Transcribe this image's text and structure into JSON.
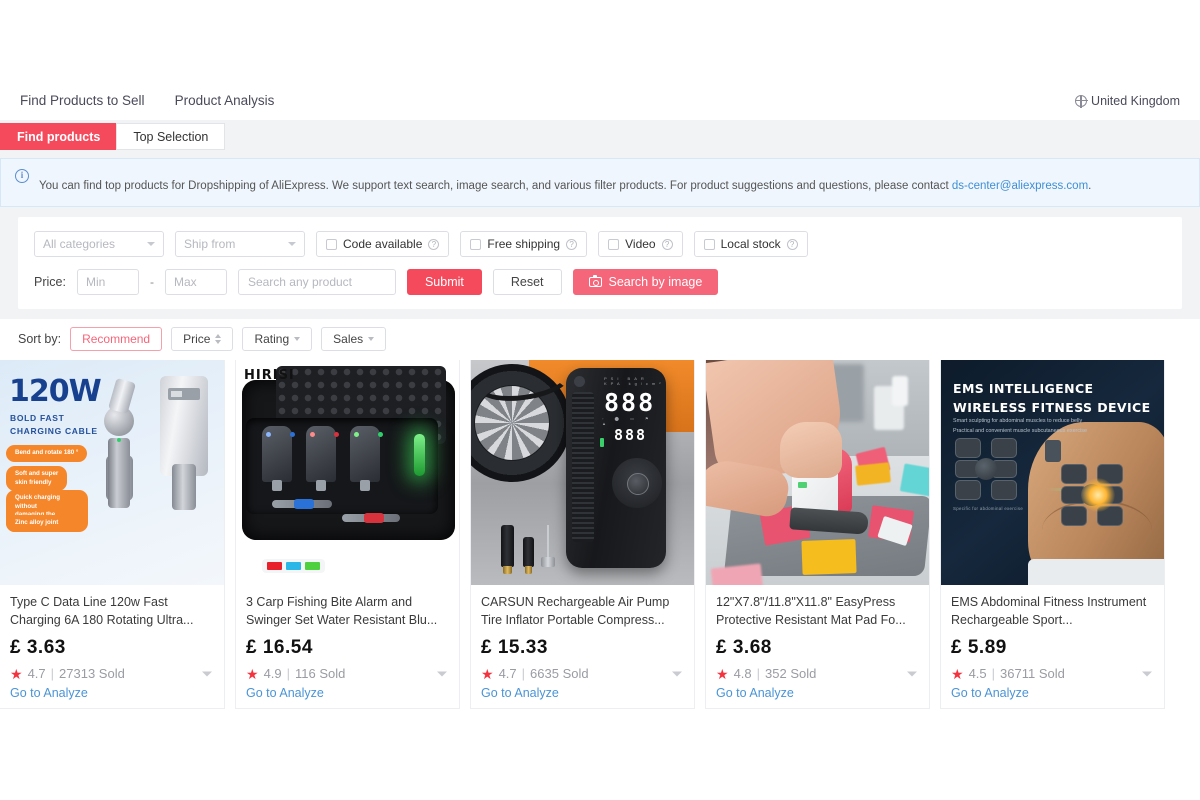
{
  "topnav": {
    "items": [
      {
        "label": "Find Products to Sell"
      },
      {
        "label": "Product Analysis"
      }
    ],
    "country": {
      "label": "United Kingdom",
      "icon": "globe-icon"
    }
  },
  "tabs": [
    {
      "label": "Find products",
      "active": true
    },
    {
      "label": "Top Selection",
      "active": false
    }
  ],
  "notice": {
    "icon": "info-icon",
    "text": "You can find top products for Dropshipping of AliExpress. We support text search, image search, and various filter products. For product suggestions and questions, please contact ",
    "link": "ds-center@aliexpress.com",
    "suffix": "."
  },
  "filters": {
    "category_select": {
      "value": "All categories",
      "icon": "chevron-down-icon"
    },
    "shipfrom_select": {
      "value": "Ship from",
      "icon": "chevron-down-icon"
    },
    "checkboxes": [
      {
        "label": "Code available",
        "checked": false,
        "help": "?"
      },
      {
        "label": "Free shipping",
        "checked": false,
        "help": "?"
      },
      {
        "label": "Video",
        "checked": false,
        "help": "?"
      },
      {
        "label": "Local stock",
        "checked": false,
        "help": "?"
      }
    ],
    "price_label": "Price:",
    "price_min_placeholder": "Min",
    "price_max_placeholder": "Max",
    "price_separator": "-",
    "search_placeholder": "Search any product",
    "submit_label": "Submit",
    "reset_label": "Reset",
    "search_by_image_label": "Search by image",
    "search_by_image_icon": "camera-icon"
  },
  "sort": {
    "label": "Sort by:",
    "options": [
      {
        "label": "Recommend",
        "active": true,
        "icon": null
      },
      {
        "label": "Price",
        "active": false,
        "icon": "sort-updown-icon"
      },
      {
        "label": "Rating",
        "active": false,
        "icon": "chevron-down-icon"
      },
      {
        "label": "Sales",
        "active": false,
        "icon": "chevron-down-icon"
      }
    ]
  },
  "products": [
    {
      "title": "Type C Data Line 120w Fast Charging 6A 180 Rotating Ultra...",
      "price": "£ 3.63",
      "rating": "4.7",
      "sold": "27313 Sold",
      "separator": "|",
      "analyze_label": "Go to Analyze",
      "image": {
        "headline": "120W",
        "subhead": "BOLD FAST\nCHARGING CABLE",
        "pills": [
          "Bend and rotate 180 °",
          "Soft and super\nskin friendly",
          "Quick charging without\ndamaging the machine",
          "Zinc alloy joint"
        ]
      }
    },
    {
      "title": "3 Carp Fishing Bite Alarm and Swinger Set Water Resistant Blu...",
      "price": "£ 16.54",
      "rating": "4.9",
      "sold": "116 Sold",
      "separator": "|",
      "analyze_label": "Go to Analyze",
      "image": {
        "brand": "HIRISI",
        "legend_colors": [
          "#e8202c",
          "#2bb6e8",
          "#4fd13f"
        ]
      }
    },
    {
      "title": "CARSUN Rechargeable Air Pump Tire Inflator Portable Compress...",
      "price": "£ 15.33",
      "rating": "4.7",
      "sold": "6635 Sold",
      "separator": "|",
      "analyze_label": "Go to Analyze",
      "image": {
        "display_primary": "888",
        "display_secondary": "888"
      }
    },
    {
      "title": "12\"X7.8\"/11.8\"X11.8\" EasyPress Protective Resistant Mat Pad Fo...",
      "price": "£ 3.68",
      "rating": "4.8",
      "sold": "352 Sold",
      "separator": "|",
      "analyze_label": "Go to Analyze",
      "image": {}
    },
    {
      "title": "EMS Abdominal Fitness Instrument Rechargeable Sport...",
      "price": "£ 5.89",
      "rating": "4.5",
      "sold": "36711 Sold",
      "separator": "|",
      "analyze_label": "Go to Analyze",
      "image": {
        "headline": "EMS INTELLIGENCE\nWIRELESS FITNESS DEVICE",
        "subhead": "Smart sculpting for abdominal muscles to reduce belly\nPractical and convenient muscle subcutaneous exercise",
        "caption": "Specific for abdominal exercise"
      }
    }
  ],
  "colors": {
    "accent": "#f5495c",
    "accent_light": "#f5667a",
    "link": "#4a94d6",
    "star": "#f5333f",
    "page_bg": "#f2f3f5"
  }
}
